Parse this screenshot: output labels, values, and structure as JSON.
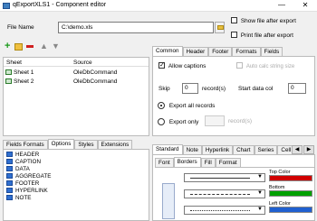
{
  "window": {
    "title": "qExportXLS1 - Component editor",
    "minimize": "—",
    "close": "✕"
  },
  "file": {
    "label": "File Name",
    "value": "C:\\demo.xls",
    "show_after_export": "Show file after export",
    "print_after_export": "Print file after export"
  },
  "sheets": {
    "col_sheet": "Sheet",
    "col_source": "Source",
    "rows": [
      {
        "sheet": "Sheet 1",
        "source": "OleDbCommand"
      },
      {
        "sheet": "Sheet 2",
        "source": "OleDbCommand"
      }
    ]
  },
  "right_tabs": [
    "Common",
    "Header",
    "Footer",
    "Formats",
    "Fields"
  ],
  "common": {
    "allow_captions": "Allow captions",
    "auto_calc": "Auto calc string size",
    "skip_label": "Skip",
    "skip_value": "0",
    "records_unit": "record(s)",
    "start_col_label": "Start data col",
    "start_col_value": "0",
    "export_all": "Export all records",
    "export_only": "Export only",
    "export_only_unit": "record(s)"
  },
  "bottom_left_tabs": [
    "Fields Formats",
    "Options",
    "Styles",
    "Extensions"
  ],
  "formats": [
    "HEADER",
    "CAPTION",
    "DATA",
    "AGGREGATE",
    "FOOTER",
    "HYPERLINK",
    "NOTE"
  ],
  "bottom_right_tabs": [
    "Standard",
    "Note",
    "Hyperlink",
    "Chart",
    "Series",
    "Cell"
  ],
  "sub_tabs": [
    "Font",
    "Borders",
    "Fill",
    "Format"
  ],
  "borders": {
    "top": "Top Color",
    "bottom": "Bottom",
    "left": "Left Color",
    "top_color": "#d00000",
    "bottom_color": "#00a000",
    "left_color": "#2060d0"
  }
}
